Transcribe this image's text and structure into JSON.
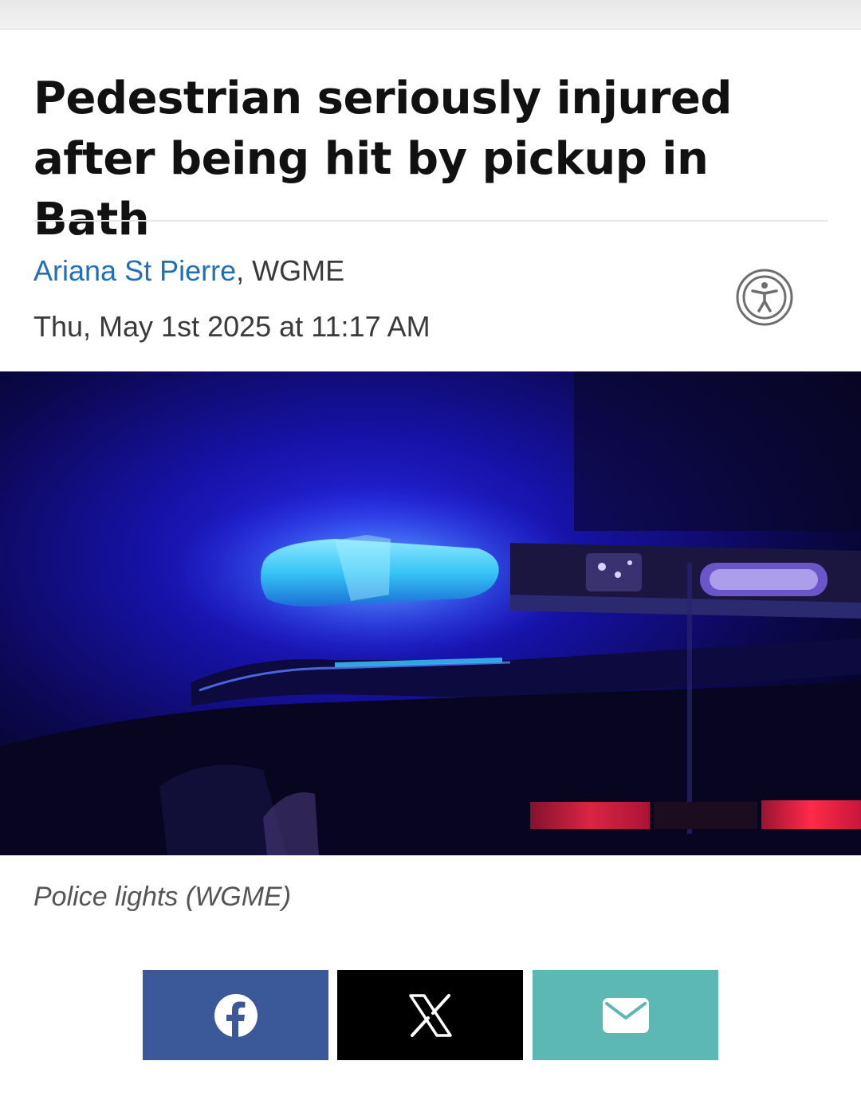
{
  "article": {
    "headline_line1": "Pedestrian seriously injured",
    "headline_line2": "after being hit by pickup in Bath",
    "author": "Ariana St Pierre",
    "byline_separator": ", ",
    "outlet": "WGME",
    "date": "Thu, May 1st 2025 at 11:17 AM",
    "image_caption": "Police lights (WGME)"
  },
  "share": {
    "buttons": [
      {
        "network": "facebook",
        "icon": "facebook-icon",
        "color": "#3b5998"
      },
      {
        "network": "x",
        "icon": "x-icon",
        "color": "#000000"
      },
      {
        "network": "email",
        "icon": "email-icon",
        "color": "#5bb8b3"
      }
    ]
  },
  "accessibility": {
    "icon": "accessibility-icon"
  },
  "colors": {
    "author_link": "#1f6fb8",
    "headline": "#111111"
  }
}
